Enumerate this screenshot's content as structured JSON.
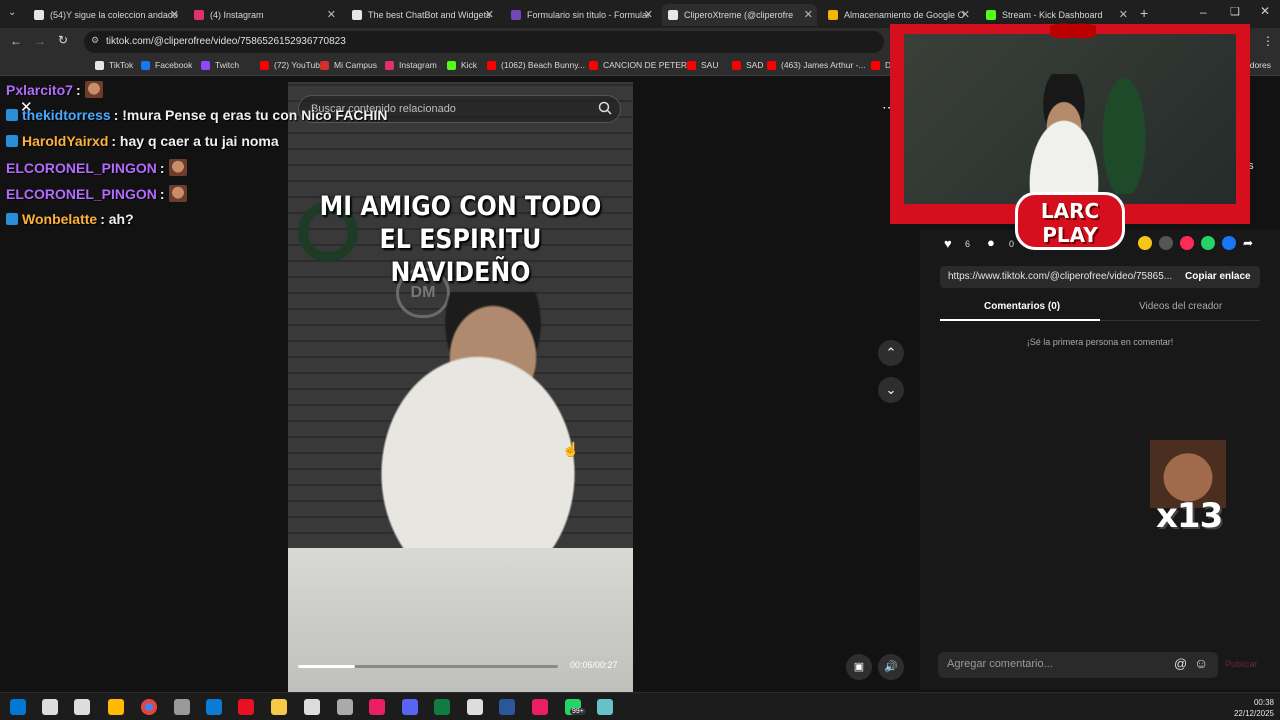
{
  "browser": {
    "tabs": [
      {
        "label": "(54)Y sigue la coleccion andado",
        "color": "#e6e6e6",
        "active": false
      },
      {
        "label": "(4) Instagram",
        "color": "#e1306c",
        "active": false
      },
      {
        "label": "The best ChatBot and Widgets",
        "color": "#e6e6e6",
        "active": false
      },
      {
        "label": "Formulario sin título - Formular",
        "color": "#7248b9",
        "active": false
      },
      {
        "label": "CliperoXtreme (@cliperofre",
        "color": "#e6e6e6",
        "active": true
      },
      {
        "label": "Almacenamiento de Google O",
        "color": "#f4b400",
        "active": false
      },
      {
        "label": "Stream - Kick Dashboard",
        "color": "#53fc18",
        "active": false
      }
    ],
    "url": "tiktok.com/@cliperofree/video/7586526152936770823",
    "bookmarks": [
      {
        "label": "TikTok",
        "color": "#e6e6e6"
      },
      {
        "label": "Facebook",
        "color": "#1877f2"
      },
      {
        "label": "Twitch",
        "color": "#9146ff"
      },
      {
        "label": "(72) YouTube",
        "color": "#ff0000"
      },
      {
        "label": "Mi Campus",
        "color": "#d32f2f"
      },
      {
        "label": "Instagram",
        "color": "#e1306c"
      },
      {
        "label": "Kick",
        "color": "#53fc18"
      },
      {
        "label": "(1062) Beach Bunny...",
        "color": "#ff0000"
      },
      {
        "label": "CANCION DE PETER",
        "color": "#ff0000"
      },
      {
        "label": "SAU",
        "color": "#ff0000"
      },
      {
        "label": "SAD",
        "color": "#ff0000"
      },
      {
        "label": "(463) James Arthur -...",
        "color": "#ff0000"
      },
      {
        "label": "Di",
        "color": "#ff0000"
      }
    ],
    "bookmarks_overflow": "adores"
  },
  "tiktok": {
    "search_placeholder": "Buscar contenido relacionado",
    "video_caption": "MI AMIGO CON TODO EL ESPIRITU NAVIDEÑO",
    "video_time": "00:06/00:27",
    "progress": 0.22,
    "likes": "6",
    "comments": "0",
    "share_link": "https://www.tiktok.com/@cliperofree/video/75865...",
    "copy_label": "Copiar enlace",
    "tab_comments": "Comentarios (0)",
    "tab_creator": "Videos del creador",
    "empty_comments": "¡Sé la primera persona en comentar!",
    "comment_placeholder": "Agregar comentario...",
    "publish_label": "Publicar",
    "side_text": "ás"
  },
  "chat": [
    {
      "user": "Pxlarcito7",
      "msg": "",
      "color": "#b36bff",
      "emote": true,
      "badge": false
    },
    {
      "user": "thekidtorress",
      "msg": ": !mura Pense q eras tu con Nico FACHIN",
      "color": "#4aa8ff",
      "emote": false,
      "badge": true
    },
    {
      "user": "HaroldYairxd",
      "msg": ": hay q caer a tu jai noma",
      "color": "#ffb13b",
      "emote": false,
      "badge": true
    },
    {
      "user": "ELCORONEL_PINGON",
      "msg": "",
      "color": "#b36bff",
      "emote": true,
      "badge": false
    },
    {
      "user": "ELCORONEL_PINGON",
      "msg": "",
      "color": "#b36bff",
      "emote": true,
      "badge": false
    },
    {
      "user": "Wonbelatte",
      "msg": ": ah?",
      "color": "#ffb13b",
      "emote": false,
      "badge": true
    }
  ],
  "overlay": {
    "logo_line1": "LARC",
    "logo_line2": "PLAY",
    "combo_count": "x13"
  },
  "taskbar": {
    "time": "00:38",
    "date": "22/12/2025",
    "badge": "99+"
  }
}
